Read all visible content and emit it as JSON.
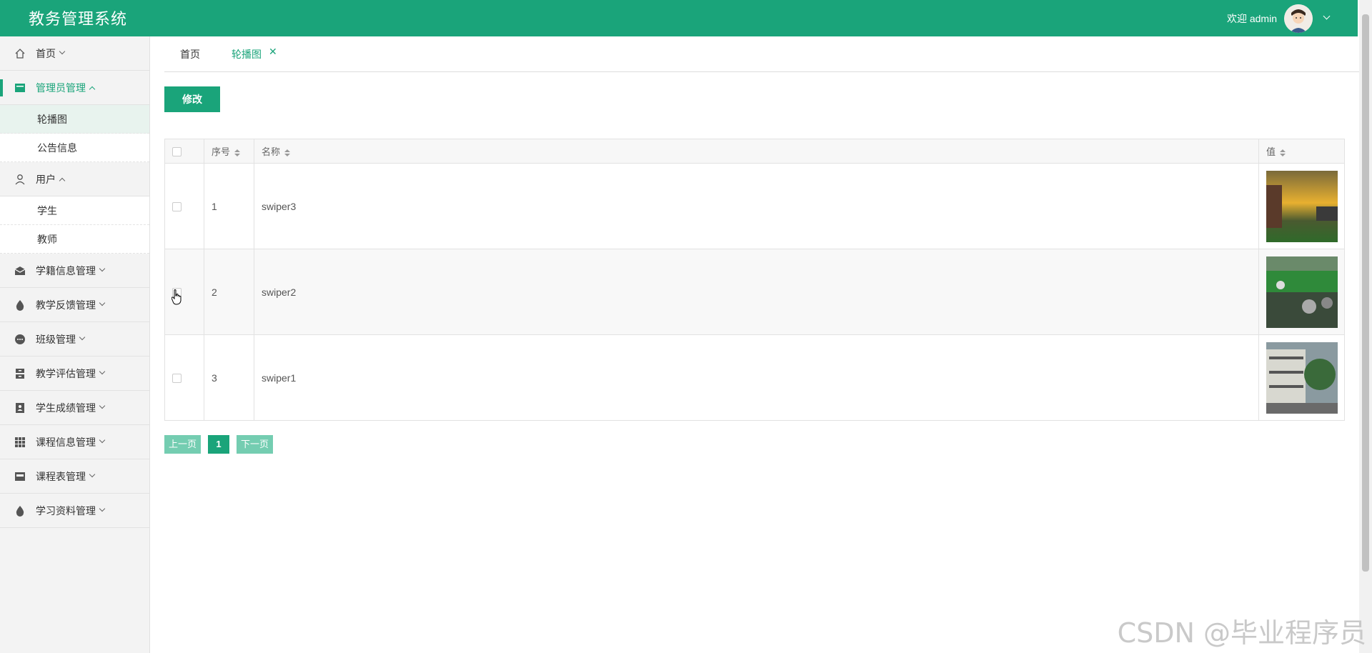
{
  "header": {
    "title": "教务管理系统",
    "welcome": "欢迎 admin"
  },
  "sidebar": {
    "items": [
      {
        "label": "首页",
        "icon": "home-icon",
        "expanded": false
      },
      {
        "label": "管理员管理",
        "icon": "admin-card-icon",
        "expanded": true,
        "active": true,
        "children": [
          {
            "label": "轮播图",
            "selected": true
          },
          {
            "label": "公告信息"
          }
        ]
      },
      {
        "label": "用户",
        "icon": "user-icon",
        "expanded": true,
        "children": [
          {
            "label": "学生"
          },
          {
            "label": "教师"
          }
        ]
      },
      {
        "label": "学籍信息管理",
        "icon": "envelope-icon",
        "expanded": false
      },
      {
        "label": "教学反馈管理",
        "icon": "drop-icon",
        "expanded": false
      },
      {
        "label": "班级管理",
        "icon": "dots-circle-icon",
        "expanded": false
      },
      {
        "label": "教学评估管理",
        "icon": "server-icon",
        "expanded": false
      },
      {
        "label": "学生成绩管理",
        "icon": "contact-book-icon",
        "expanded": false
      },
      {
        "label": "课程信息管理",
        "icon": "grid-icon",
        "expanded": false
      },
      {
        "label": "课程表管理",
        "icon": "store-icon",
        "expanded": false
      },
      {
        "label": "学习资料管理",
        "icon": "drop-icon",
        "expanded": false
      }
    ]
  },
  "tabs": [
    {
      "label": "首页",
      "active": false
    },
    {
      "label": "轮播图",
      "active": true,
      "closable": true
    }
  ],
  "toolbar": {
    "edit_label": "修改"
  },
  "table": {
    "columns": [
      "序号",
      "名称",
      "值"
    ],
    "rows": [
      {
        "index": "1",
        "name": "swiper3",
        "image": "sunset-campus-photo"
      },
      {
        "index": "2",
        "name": "swiper2",
        "image": "sports-field-photo"
      },
      {
        "index": "3",
        "name": "swiper1",
        "image": "school-building-photo"
      }
    ]
  },
  "pagination": {
    "prev": "上一页",
    "current": "1",
    "next": "下一页"
  },
  "watermark": "CSDN @毕业程序员",
  "colors": {
    "primary": "#1aa47a",
    "primary_light": "#74cdb1"
  }
}
